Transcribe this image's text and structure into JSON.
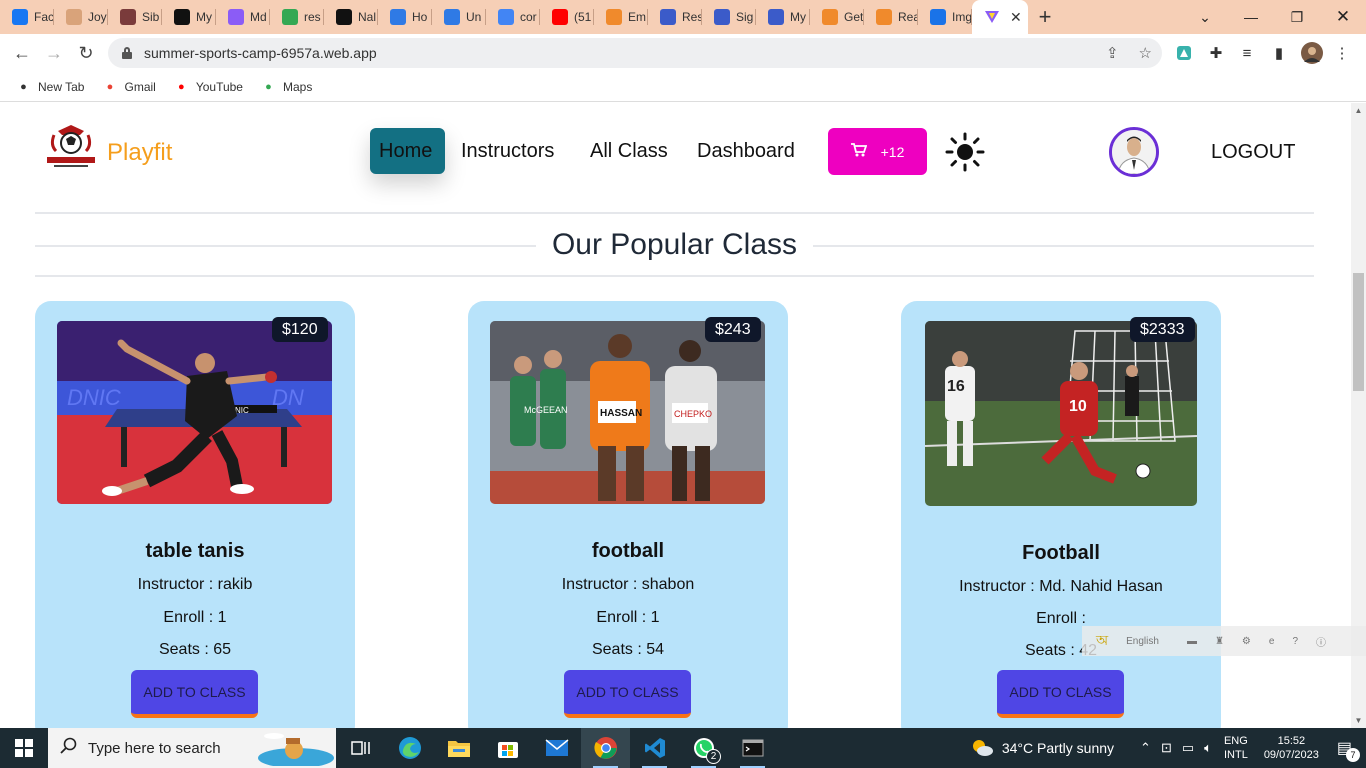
{
  "browser": {
    "tabs": [
      {
        "label": "Fac",
        "icon": "facebook-icon",
        "color": "#1877f2"
      },
      {
        "label": "Joy",
        "icon": "hand-icon",
        "color": "#d9a37a"
      },
      {
        "label": "Sib",
        "icon": "image-icon",
        "color": "#7a3b3b"
      },
      {
        "label": "My",
        "icon": "github-icon",
        "color": "#111111"
      },
      {
        "label": "Md",
        "icon": "vite-icon",
        "color": "#8b5cf6"
      },
      {
        "label": "res",
        "icon": "drive-icon",
        "color": "#34a853"
      },
      {
        "label": "Nal",
        "icon": "github-icon",
        "color": "#111111"
      },
      {
        "label": "Ho",
        "icon": "copilot-icon",
        "color": "#2f7ae5"
      },
      {
        "label": "Un",
        "icon": "copilot-icon",
        "color": "#2f7ae5"
      },
      {
        "label": "cor",
        "icon": "google-icon",
        "color": "#4285f4"
      },
      {
        "label": "(51",
        "icon": "youtube-icon",
        "color": "#ff0000"
      },
      {
        "label": "Em",
        "icon": "shield-icon",
        "color": "#f08a2c"
      },
      {
        "label": "Res",
        "icon": "shield-icon",
        "color": "#3b5bc9"
      },
      {
        "label": "Sig",
        "icon": "shield-icon",
        "color": "#3b5bc9"
      },
      {
        "label": "My",
        "icon": "shield-icon",
        "color": "#3b5bc9"
      },
      {
        "label": "Get",
        "icon": "shield-icon",
        "color": "#f08a2c"
      },
      {
        "label": "Rea",
        "icon": "shield-icon",
        "color": "#f08a2c"
      },
      {
        "label": "Img",
        "icon": "imgbb-icon",
        "color": "#1a73e8"
      }
    ],
    "url": "summer-sports-camp-6957a.web.app",
    "bookmarks": [
      {
        "label": "New Tab",
        "icon": "globe-icon",
        "color": "#333333"
      },
      {
        "label": "Gmail",
        "icon": "gmail-icon",
        "color": "#ea4335"
      },
      {
        "label": "YouTube",
        "icon": "youtube-icon",
        "color": "#ff0000"
      },
      {
        "label": "Maps",
        "icon": "maps-icon",
        "color": "#34a853"
      }
    ]
  },
  "site": {
    "brand": "Playfit",
    "nav": {
      "home": "Home",
      "instructors": "Instructors",
      "all_class": "All Class",
      "dashboard": "Dashboard"
    },
    "cart_count": "+12",
    "logout": "LOGOUT",
    "section_title": "Our Popular Class",
    "classes": [
      {
        "price": "$120",
        "name": "table tanis",
        "instructor": "Instructor : rakib",
        "enroll": "Enroll : 1",
        "seats": "Seats : 65",
        "button": "ADD TO CLASS"
      },
      {
        "price": "$243",
        "name": "football",
        "instructor": "Instructor : shabon",
        "enroll": "Enroll : 1",
        "seats": "Seats : 54",
        "button": "ADD TO CLASS"
      },
      {
        "price": "$2333",
        "name": "Football",
        "instructor": "Instructor : Md. Nahid Hasan",
        "enroll": "Enroll :",
        "seats": "Seats : 42",
        "button": "ADD TO CLASS"
      }
    ],
    "colors": {
      "brand": "#f59e1c",
      "nav_active": "#137083",
      "cart": "#ee00c0",
      "card_bg": "#b8e3fa",
      "button": "#4f46e5",
      "button_border": "#f97316"
    }
  },
  "langbar": {
    "label": "English"
  },
  "taskbar": {
    "search_placeholder": "Type here to search",
    "weather": "34°C  Partly sunny",
    "lang_top": "ENG",
    "lang_bottom": "INTL",
    "time": "15:52",
    "date": "09/07/2023",
    "whatsapp_badge": "2",
    "notifications": "7"
  }
}
